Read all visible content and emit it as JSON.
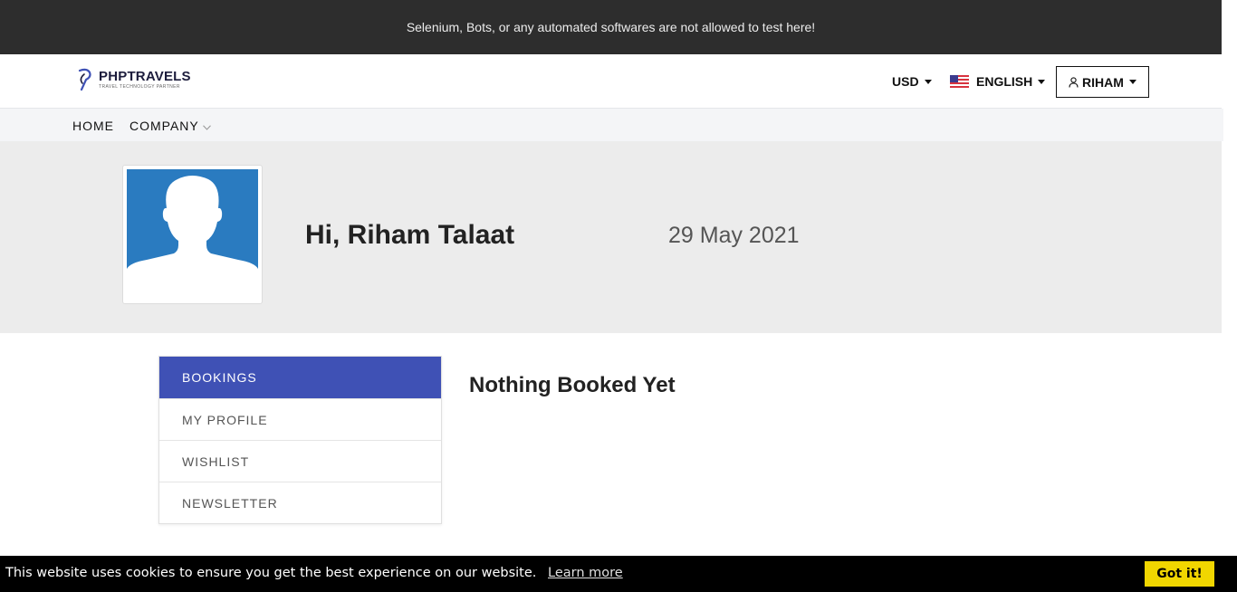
{
  "topbar": {
    "message": "Selenium, Bots, or any automated softwares are not allowed to test here!"
  },
  "header": {
    "logo_name": "PHPTRAVELS",
    "logo_tagline": "TRAVEL TECHNOLOGY PARTNER",
    "currency": "USD",
    "language": "ENGLISH",
    "language_flag": "us-flag-icon",
    "user": "RIHAM"
  },
  "nav": {
    "items": [
      {
        "label": "HOME"
      },
      {
        "label": "COMPANY"
      }
    ]
  },
  "profile": {
    "greeting": "Hi, Riham Talaat",
    "date": "29 May 2021",
    "avatar_icon": "default-user-silhouette"
  },
  "account_menu": {
    "items": [
      {
        "label": "BOOKINGS",
        "active": true
      },
      {
        "label": "MY PROFILE",
        "active": false
      },
      {
        "label": "WISHLIST",
        "active": false
      },
      {
        "label": "NEWSLETTER",
        "active": false
      }
    ]
  },
  "content": {
    "empty_title": "Nothing Booked Yet"
  },
  "cookie_banner": {
    "message": "This website uses cookies to ensure you get the best experience on our website.",
    "link": "Learn more",
    "button": "Got it!"
  },
  "colors": {
    "topbar_bg": "#2d2d2d",
    "accent": "#3f51b5",
    "hero_bg": "#ececec",
    "cookie_button": "#f1d600"
  }
}
